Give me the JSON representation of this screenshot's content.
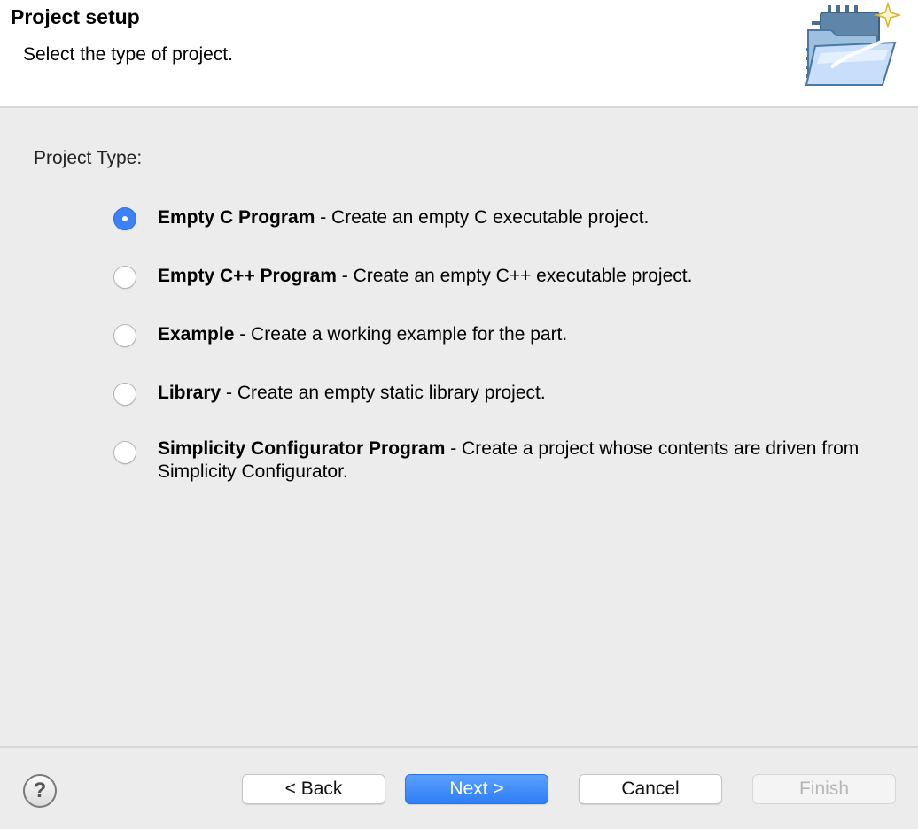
{
  "header": {
    "title": "Project setup",
    "subtitle": "Select the type of project."
  },
  "content": {
    "group_label": "Project Type:",
    "options": [
      {
        "name": "Empty C Program",
        "description": " - Create an empty C executable project.",
        "checked": true
      },
      {
        "name": "Empty C++ Program",
        "description": " - Create an empty C++ executable project.",
        "checked": false
      },
      {
        "name": "Example",
        "description": " - Create a working example for the part.",
        "checked": false
      },
      {
        "name": "Library",
        "description": " - Create an empty static library project.",
        "checked": false
      },
      {
        "name": "Simplicity Configurator Program",
        "description": " - Create a project whose contents are driven from Simplicity Configurator.",
        "checked": false
      }
    ]
  },
  "footer": {
    "help_icon": "?",
    "back_label": "< Back",
    "next_label": "Next >",
    "cancel_label": "Cancel",
    "finish_label": "Finish"
  },
  "colors": {
    "accent": "#3b82f6",
    "background": "#ececec"
  }
}
